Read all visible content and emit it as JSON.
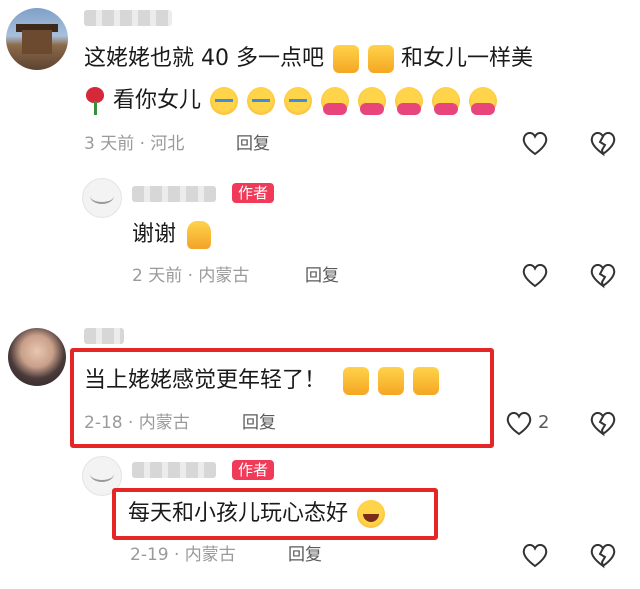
{
  "comments": [
    {
      "text": "这姥姥也就 40 多一点吧",
      "text_after": "和女儿一样美",
      "line2": "看你女儿",
      "meta": "3 天前 · 河北",
      "reply": "回复"
    },
    {
      "badge": "作者",
      "text": "谢谢",
      "meta": "2 天前 · 内蒙古",
      "reply": "回复"
    },
    {
      "text": "当上姥姥感觉更年轻了！",
      "meta": "2-18 · 内蒙古",
      "reply": "回复",
      "likes": "2"
    },
    {
      "badge": "作者",
      "text": "每天和小孩儿玩心态好",
      "meta": "2-19 · 内蒙古",
      "reply": "回复"
    }
  ],
  "icons": {
    "like": "heart-outline-icon",
    "dislike": "broken-heart-icon"
  },
  "colors": {
    "badge": "#f03a58",
    "highlight_box": "#e52626",
    "meta": "#9a9a9a"
  }
}
